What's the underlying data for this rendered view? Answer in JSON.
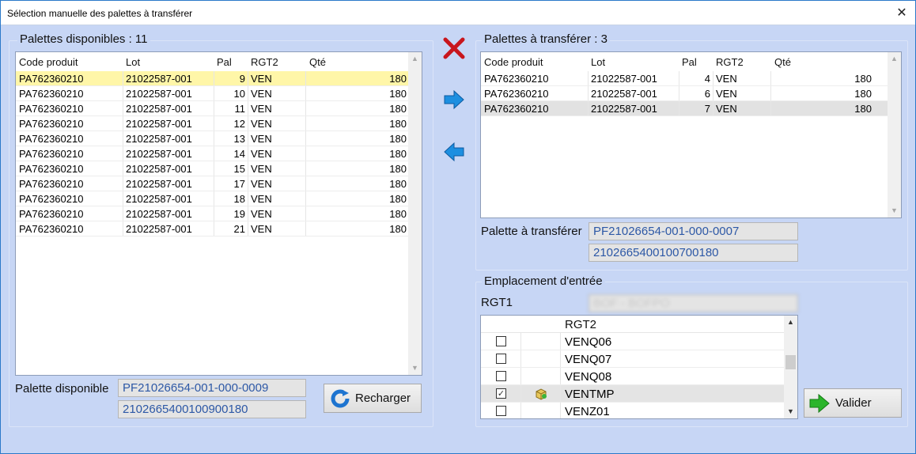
{
  "window": {
    "title": "Sélection manuelle des palettes à transférer",
    "close_glyph": "✕"
  },
  "available": {
    "title": "Palettes disponibles : 11",
    "columns": [
      "Code produit",
      "Lot",
      "Pal",
      "RGT2",
      "Qté"
    ],
    "rows": [
      [
        "PA762360210",
        "21022587-001",
        "9",
        "VEN",
        "180"
      ],
      [
        "PA762360210",
        "21022587-001",
        "10",
        "VEN",
        "180"
      ],
      [
        "PA762360210",
        "21022587-001",
        "11",
        "VEN",
        "180"
      ],
      [
        "PA762360210",
        "21022587-001",
        "12",
        "VEN",
        "180"
      ],
      [
        "PA762360210",
        "21022587-001",
        "13",
        "VEN",
        "180"
      ],
      [
        "PA762360210",
        "21022587-001",
        "14",
        "VEN",
        "180"
      ],
      [
        "PA762360210",
        "21022587-001",
        "15",
        "VEN",
        "180"
      ],
      [
        "PA762360210",
        "21022587-001",
        "17",
        "VEN",
        "180"
      ],
      [
        "PA762360210",
        "21022587-001",
        "18",
        "VEN",
        "180"
      ],
      [
        "PA762360210",
        "21022587-001",
        "19",
        "VEN",
        "180"
      ],
      [
        "PA762360210",
        "21022587-001",
        "21",
        "VEN",
        "180"
      ]
    ],
    "selected_row": 0,
    "pallet_label": "Palette disponible",
    "pallet_id": "PF21026654-001-000-0009",
    "pallet_barcode": "2102665400100900180",
    "reload_label": "Recharger"
  },
  "transfer": {
    "title": "Palettes à transférer : 3",
    "columns": [
      "Code produit",
      "Lot",
      "Pal",
      "RGT2",
      "Qté"
    ],
    "rows": [
      [
        "PA762360210",
        "21022587-001",
        "4",
        "VEN",
        "180"
      ],
      [
        "PA762360210",
        "21022587-001",
        "6",
        "VEN",
        "180"
      ],
      [
        "PA762360210",
        "21022587-001",
        "7",
        "VEN",
        "180"
      ]
    ],
    "selected_row": 2,
    "pallet_label": "Palette à transférer",
    "pallet_id": "PF21026654-001-000-0007",
    "pallet_barcode": "2102665400100700180"
  },
  "entry": {
    "title": "Emplacement d'entrée",
    "rgt1_label": "RGT1",
    "rgt1_value": "BOF - BOFPO",
    "list_header": "RGT2",
    "items": [
      {
        "label": "VENQ06",
        "checked": false
      },
      {
        "label": "VENQ07",
        "checked": false
      },
      {
        "label": "VENQ08",
        "checked": false
      },
      {
        "label": "VENTMP",
        "checked": true
      },
      {
        "label": "VENZ01",
        "checked": false
      }
    ],
    "validate_label": "Valider"
  },
  "colors": {
    "background": "#c7d6f5",
    "selected_row": "#fff6a8",
    "field_text": "#2d58a6",
    "delete_red": "#c8161d",
    "arrow_blue": "#1d8fe0",
    "validate_green": "#2bb52b"
  },
  "icons": {
    "delete": "red-x-icon",
    "move_right": "arrow-right-icon",
    "move_left": "arrow-left-icon",
    "reload": "refresh-icon",
    "validate": "green-arrow-icon",
    "location": "box-icon"
  }
}
